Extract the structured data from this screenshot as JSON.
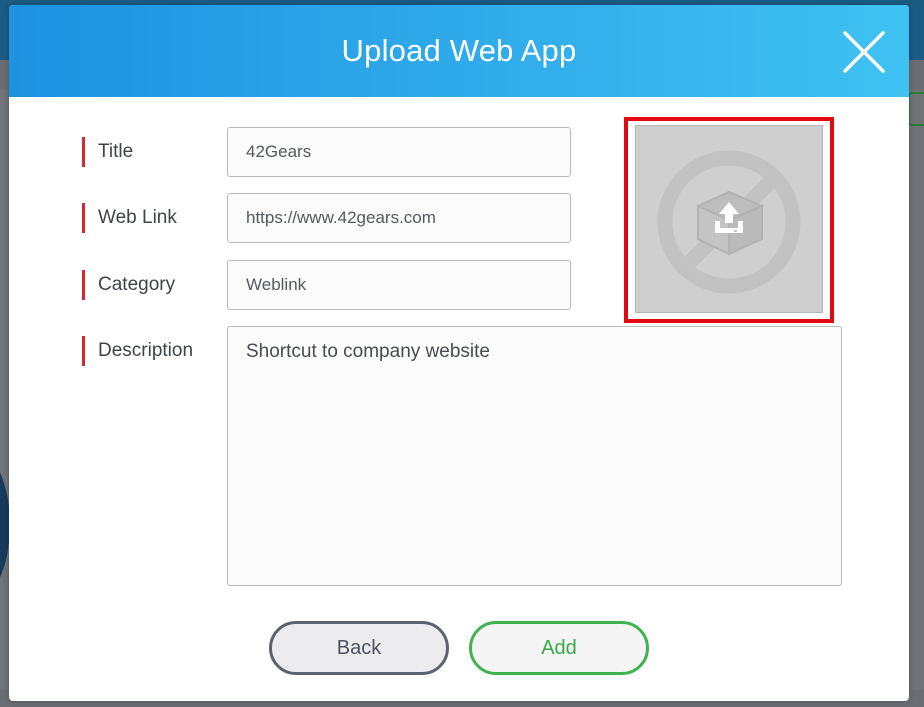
{
  "modal": {
    "title": "Upload Web App",
    "close_icon": "close-icon",
    "accent_color": "#1e92e1",
    "header_gradient_end": "#3fc2f2"
  },
  "form": {
    "title": {
      "label": "Title",
      "value": "42Gears"
    },
    "web_link": {
      "label": "Web Link",
      "value": "https://www.42gears.com"
    },
    "category": {
      "label": "Category",
      "value": "Weblink"
    },
    "description": {
      "label": "Description",
      "value": "Shortcut to company website"
    }
  },
  "icon_upload": {
    "icon": "upload-icon",
    "placeholder_icon": "no-image-icon",
    "highlight_color": "#e30613"
  },
  "buttons": {
    "back_label": "Back",
    "add_label": "Add",
    "add_color": "#3fb34f"
  },
  "label_marker_color": "#d0273a"
}
